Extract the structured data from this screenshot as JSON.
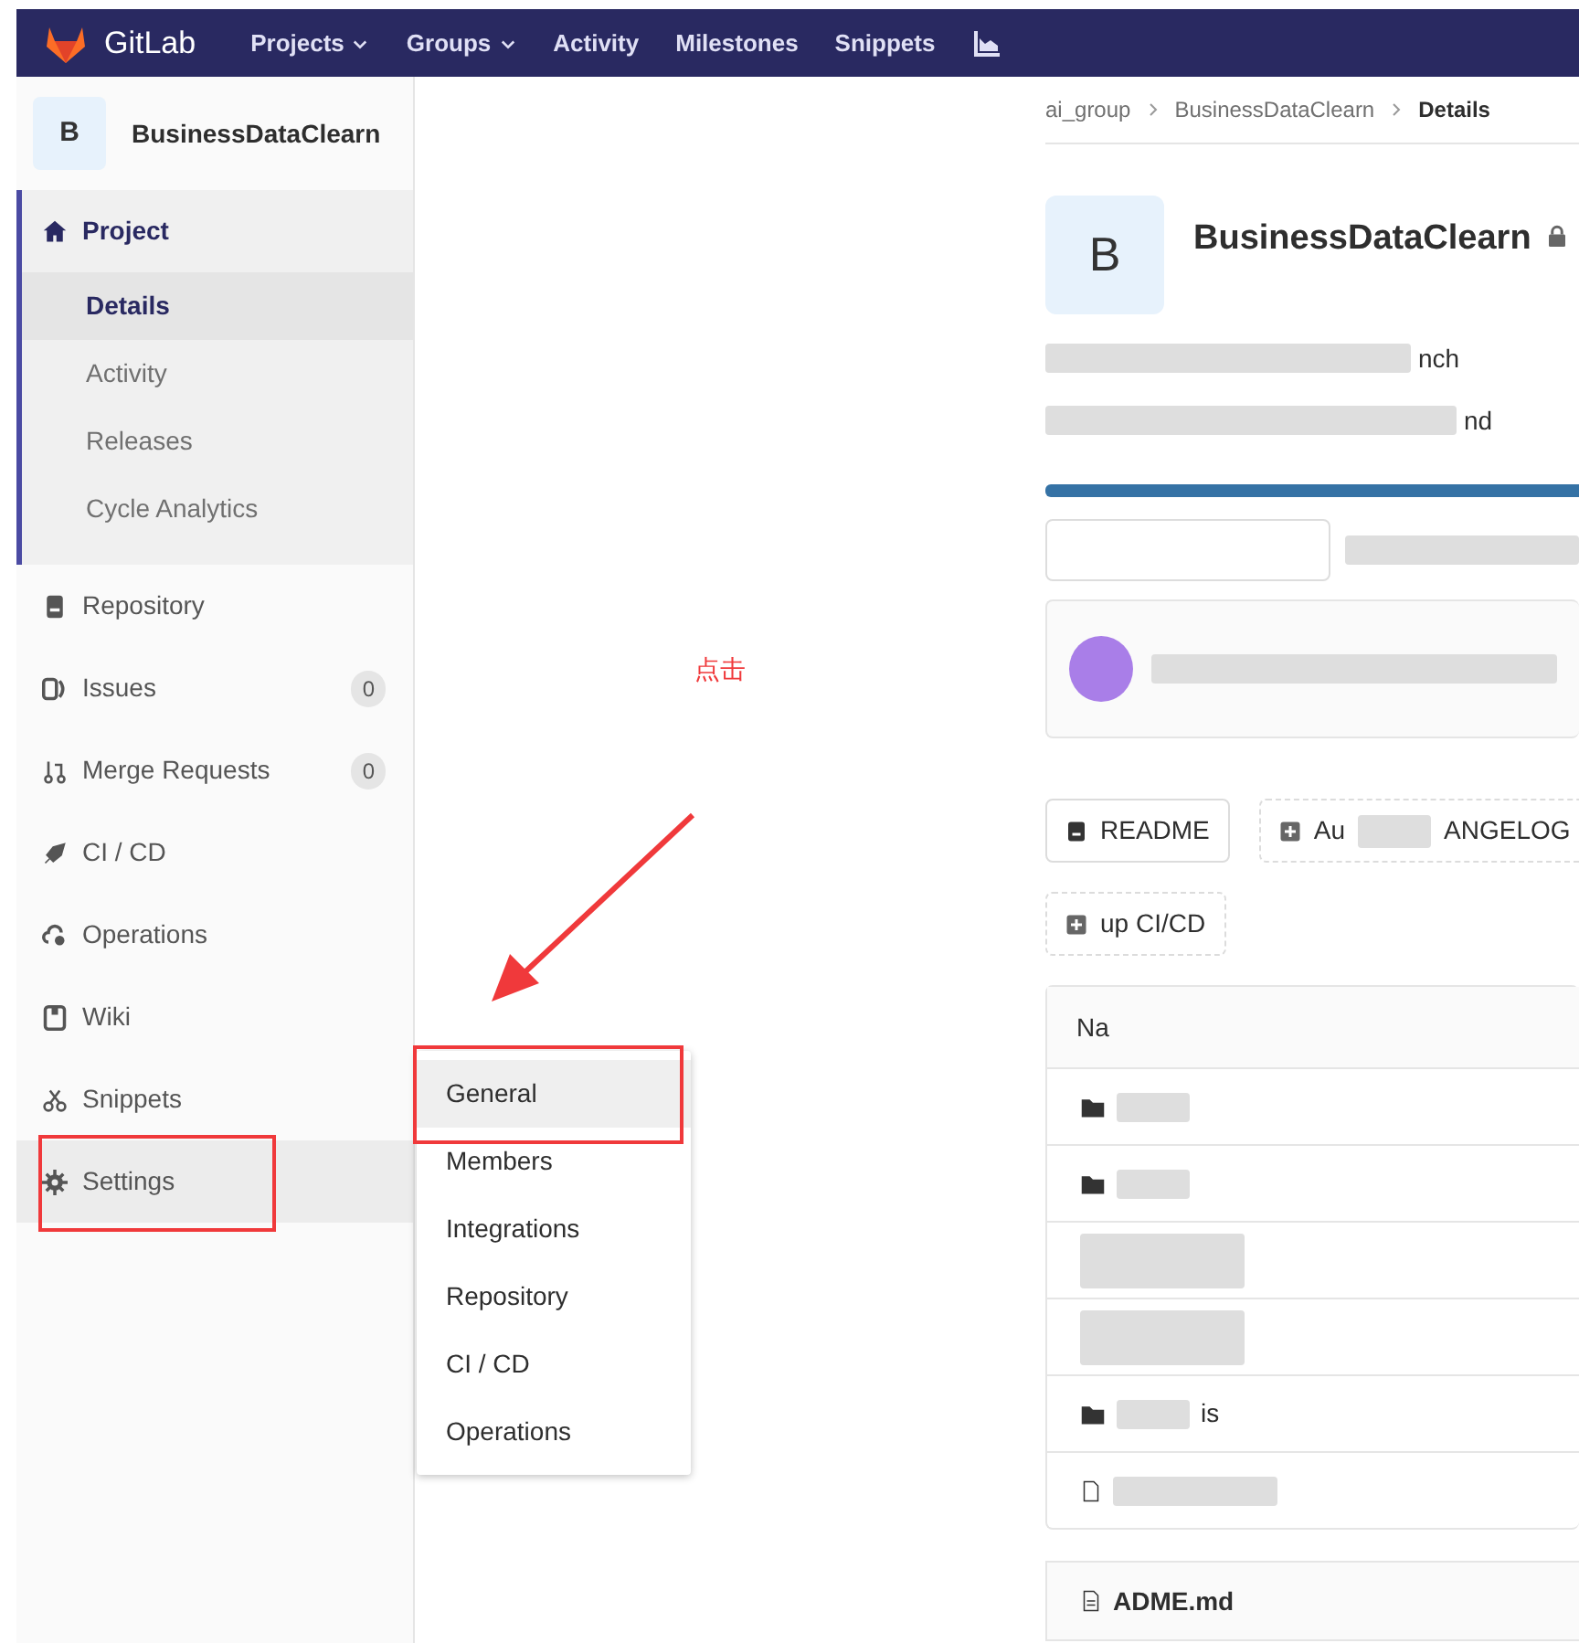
{
  "navbar": {
    "brand": "GitLab",
    "items": [
      {
        "label": "Projects",
        "dropdown": true
      },
      {
        "label": "Groups",
        "dropdown": true
      },
      {
        "label": "Activity",
        "dropdown": false
      },
      {
        "label": "Milestones",
        "dropdown": false
      },
      {
        "label": "Snippets",
        "dropdown": false
      }
    ]
  },
  "sidebar": {
    "avatar": "B",
    "project": "BusinessDataClearn",
    "items": [
      {
        "label": "Project",
        "selected": true,
        "hovered": false,
        "children": [
          {
            "label": "Details",
            "selected": true
          },
          {
            "label": "Activity",
            "selected": false
          },
          {
            "label": "Releases",
            "selected": false
          },
          {
            "label": "Cycle Analytics",
            "selected": false
          }
        ]
      },
      {
        "label": "Repository",
        "selected": false,
        "hovered": false
      },
      {
        "label": "Issues",
        "count": "0",
        "selected": false,
        "hovered": false
      },
      {
        "label": "Merge Requests",
        "count": "0",
        "selected": false,
        "hovered": false
      },
      {
        "label": "CI / CD",
        "selected": false,
        "hovered": false
      },
      {
        "label": "Operations",
        "selected": false,
        "hovered": false
      },
      {
        "label": "Wiki",
        "selected": false,
        "hovered": false
      },
      {
        "label": "Snippets",
        "selected": false,
        "hovered": false
      },
      {
        "label": "Settings",
        "selected": false,
        "hovered": true
      }
    ]
  },
  "flyout": [
    {
      "label": "General",
      "hovered": true
    },
    {
      "label": "Members",
      "hovered": false
    },
    {
      "label": "Integrations",
      "hovered": false
    },
    {
      "label": "Repository",
      "hovered": false
    },
    {
      "label": "CI / CD",
      "hovered": false
    },
    {
      "label": "Operations",
      "hovered": false
    }
  ],
  "annotation": {
    "text": "点击"
  },
  "breadcrumbs": [
    {
      "label": "ai_group",
      "current": false
    },
    {
      "label": "BusinessDataClearn",
      "current": false
    },
    {
      "label": "Details",
      "current": true
    }
  ],
  "project": {
    "avatar": "B",
    "title": "BusinessDataClearn",
    "private": true,
    "lines": [
      {
        "fragment": "nch"
      },
      {
        "fragment": "nd"
      }
    ]
  },
  "buttons": [
    {
      "label": "README",
      "kind": "file"
    },
    {
      "label": "ANGELOG",
      "kind": "add",
      "fragment": "Au"
    },
    {
      "label": "up CI/CD",
      "kind": "add"
    }
  ],
  "table": {
    "header": "Na",
    "rows": [
      {
        "kind": "folder"
      },
      {
        "kind": "folder"
      },
      {
        "kind": "blur"
      },
      {
        "kind": "blur"
      },
      {
        "kind": "folder",
        "text": "is"
      },
      {
        "kind": "file"
      }
    ]
  },
  "readme": {
    "title": "ADME.md"
  }
}
